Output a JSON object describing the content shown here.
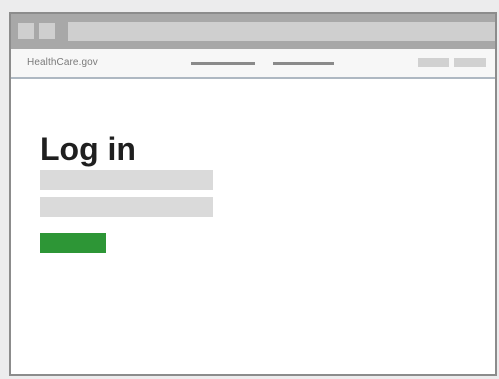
{
  "header": {
    "brand": "HealthCare.gov"
  },
  "main": {
    "title": "Log in"
  },
  "colors": {
    "primary_button": "#2d9636",
    "field_placeholder": "#dadada",
    "chrome": "#a8a8a8"
  }
}
